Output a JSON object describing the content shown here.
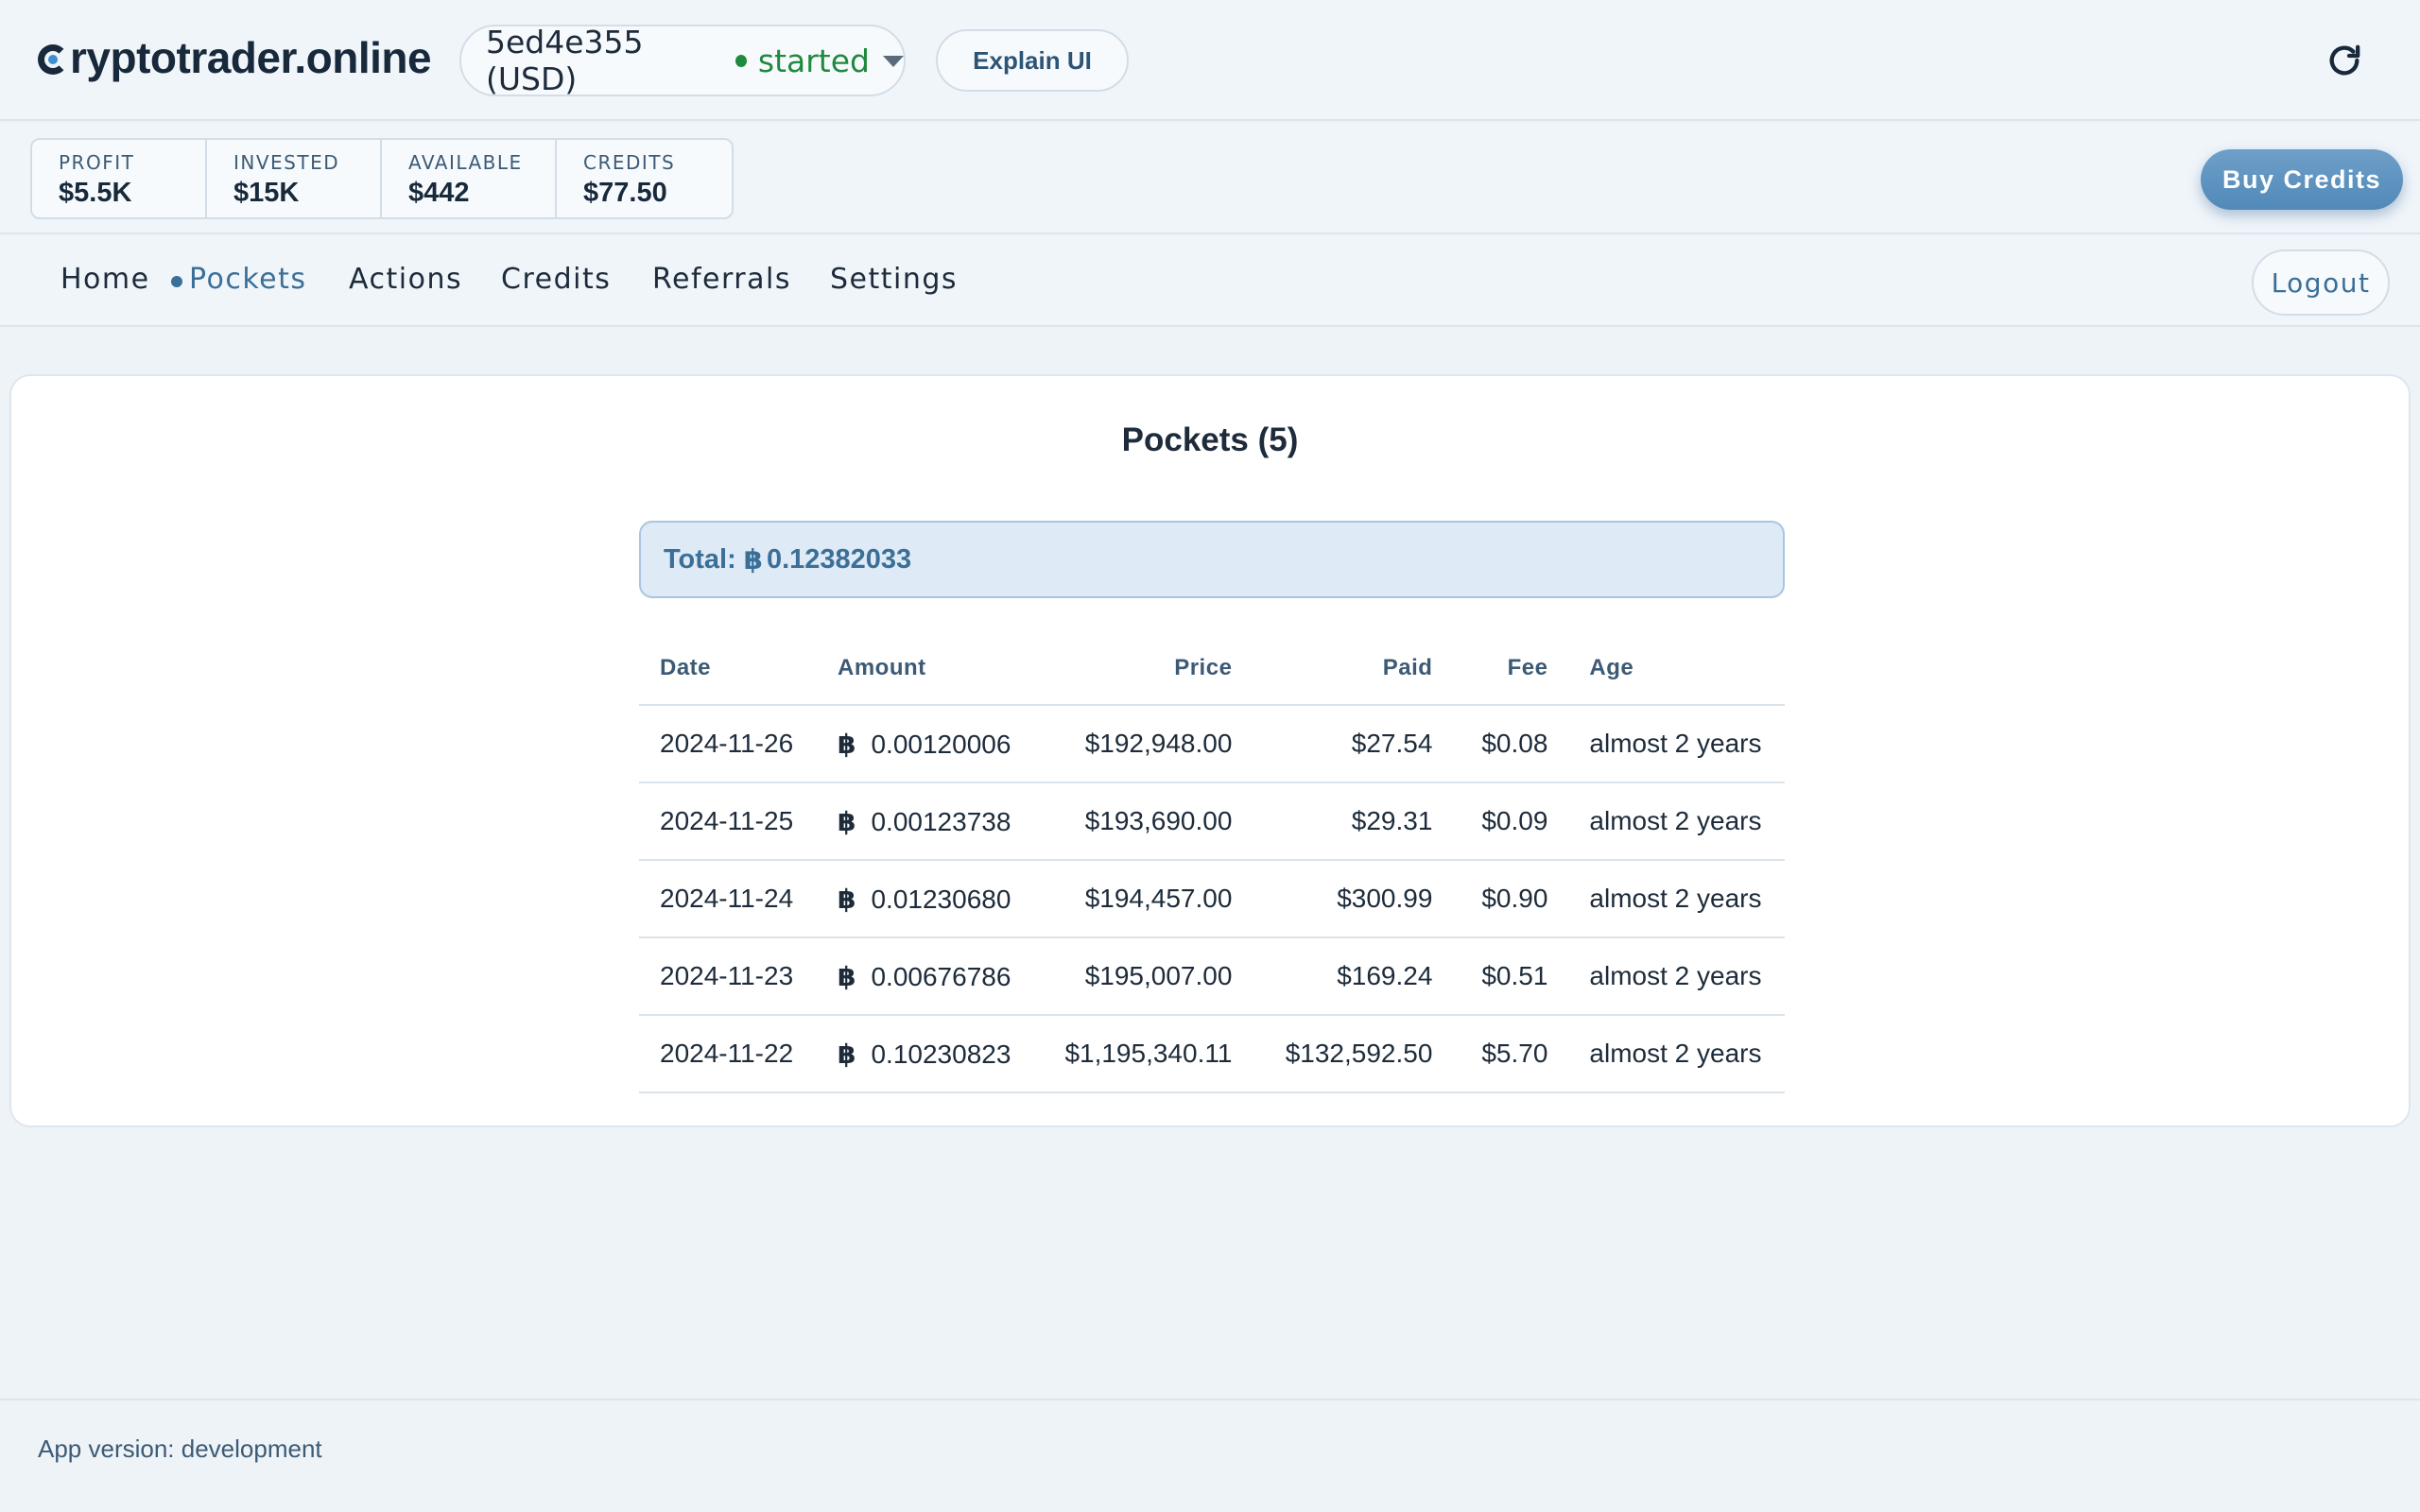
{
  "header": {
    "brand": "ryptotrader.online",
    "bot": {
      "id_currency": "5ed4e355 (USD)",
      "status": "started"
    },
    "explain_label": "Explain UI"
  },
  "stats": {
    "items": [
      {
        "label": "Profit",
        "value": "$5.5K"
      },
      {
        "label": "Invested",
        "value": "$15K"
      },
      {
        "label": "Available",
        "value": "$442"
      },
      {
        "label": "Credits",
        "value": "$77.50"
      }
    ],
    "buy_label": "Buy Credits"
  },
  "nav": {
    "items": [
      {
        "label": "Home"
      },
      {
        "label": "Pockets"
      },
      {
        "label": "Actions"
      },
      {
        "label": "Credits"
      },
      {
        "label": "Referrals"
      },
      {
        "label": "Settings"
      }
    ],
    "active": "Pockets",
    "logout_label": "Logout"
  },
  "pockets": {
    "title": "Pockets (5)",
    "total_label": "Total:",
    "btc_symbol": "฿",
    "total_value": "0.12382033",
    "columns": [
      "Date",
      "Amount",
      "Price",
      "Paid",
      "Fee",
      "Age"
    ],
    "rows": [
      {
        "date": "2024-11-26",
        "amount": "0.00120006",
        "price": "$192,948.00",
        "paid": "$27.54",
        "fee": "$0.08",
        "age": "almost 2 years"
      },
      {
        "date": "2024-11-25",
        "amount": "0.00123738",
        "price": "$193,690.00",
        "paid": "$29.31",
        "fee": "$0.09",
        "age": "almost 2 years"
      },
      {
        "date": "2024-11-24",
        "amount": "0.01230680",
        "price": "$194,457.00",
        "paid": "$300.99",
        "fee": "$0.90",
        "age": "almost 2 years"
      },
      {
        "date": "2024-11-23",
        "amount": "0.00676786",
        "price": "$195,007.00",
        "paid": "$169.24",
        "fee": "$0.51",
        "age": "almost 2 years"
      },
      {
        "date": "2024-11-22",
        "amount": "0.10230823",
        "price": "$1,195,340.11",
        "paid": "$132,592.50",
        "fee": "$5.70",
        "age": "almost 2 years"
      }
    ]
  },
  "footer": {
    "version": "App version: development"
  },
  "colors": {
    "accent": "#3b6f98",
    "status_started": "#1f8a3e",
    "buy_button": "#5b93c2",
    "total_bg": "#deeaf5"
  },
  "icons": {
    "brand": "brand-c-icon",
    "caret": "chevron-down-icon",
    "refresh": "refresh-icon",
    "bitcoin": "bitcoin-icon"
  }
}
